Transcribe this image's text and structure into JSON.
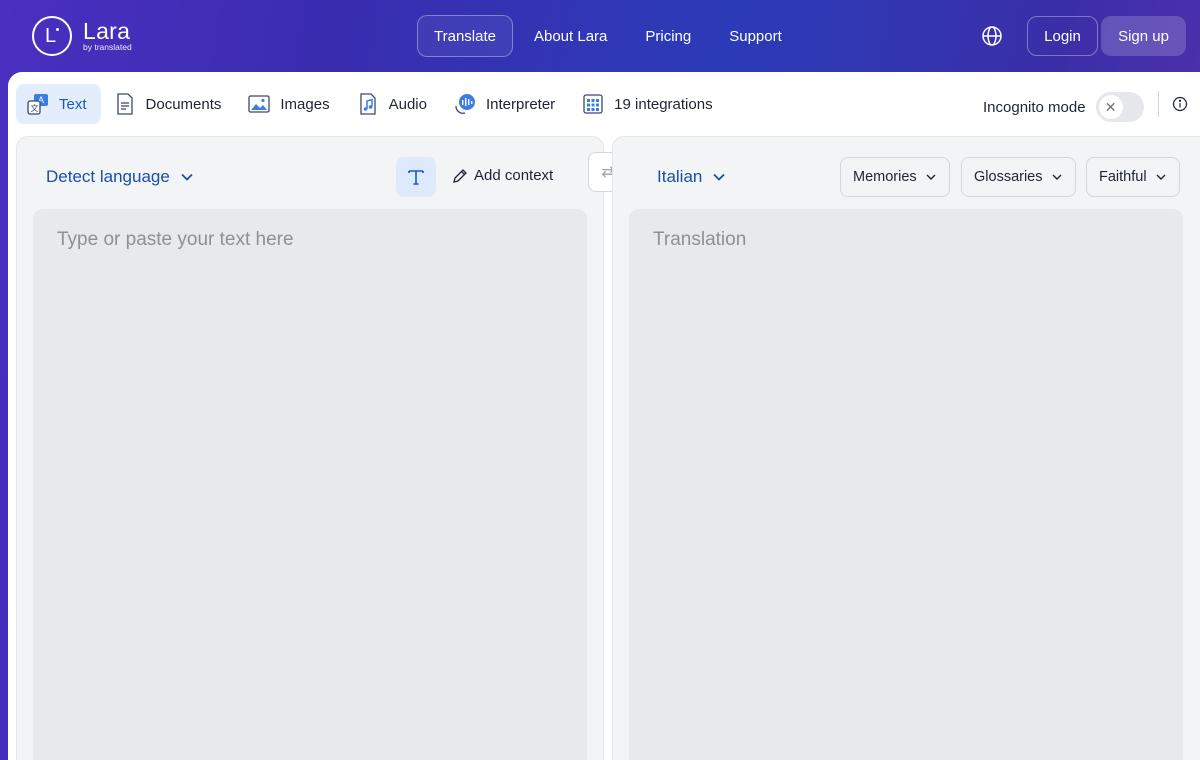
{
  "brand": {
    "name": "Lara",
    "tagline": "by translated",
    "logo_letter": "L"
  },
  "nav": {
    "items": [
      {
        "label": "Translate",
        "active": true
      },
      {
        "label": "About Lara",
        "active": false
      },
      {
        "label": "Pricing",
        "active": false
      },
      {
        "label": "Support",
        "active": false
      }
    ],
    "login": "Login",
    "signup": "Sign up"
  },
  "tabs": [
    {
      "label": "Text",
      "icon": "text-translate-icon",
      "active": true
    },
    {
      "label": "Documents",
      "icon": "document-icon",
      "active": false
    },
    {
      "label": "Images",
      "icon": "image-icon",
      "active": false
    },
    {
      "label": "Audio",
      "icon": "audio-icon",
      "active": false
    },
    {
      "label": "Interpreter",
      "icon": "interpreter-icon",
      "active": false
    },
    {
      "label": "19 integrations",
      "icon": "integrations-icon",
      "active": false
    }
  ],
  "incognito": {
    "label": "Incognito mode",
    "enabled": false
  },
  "source": {
    "language": "Detect language",
    "add_context": "Add context",
    "placeholder": "Type or paste your text here"
  },
  "target": {
    "language": "Italian",
    "placeholder": "Translation",
    "memories": "Memories",
    "glossaries": "Glossaries",
    "style": "Faithful"
  },
  "colors": {
    "accent": "#1a56c5",
    "tab_active_bg": "#e3edfb"
  }
}
